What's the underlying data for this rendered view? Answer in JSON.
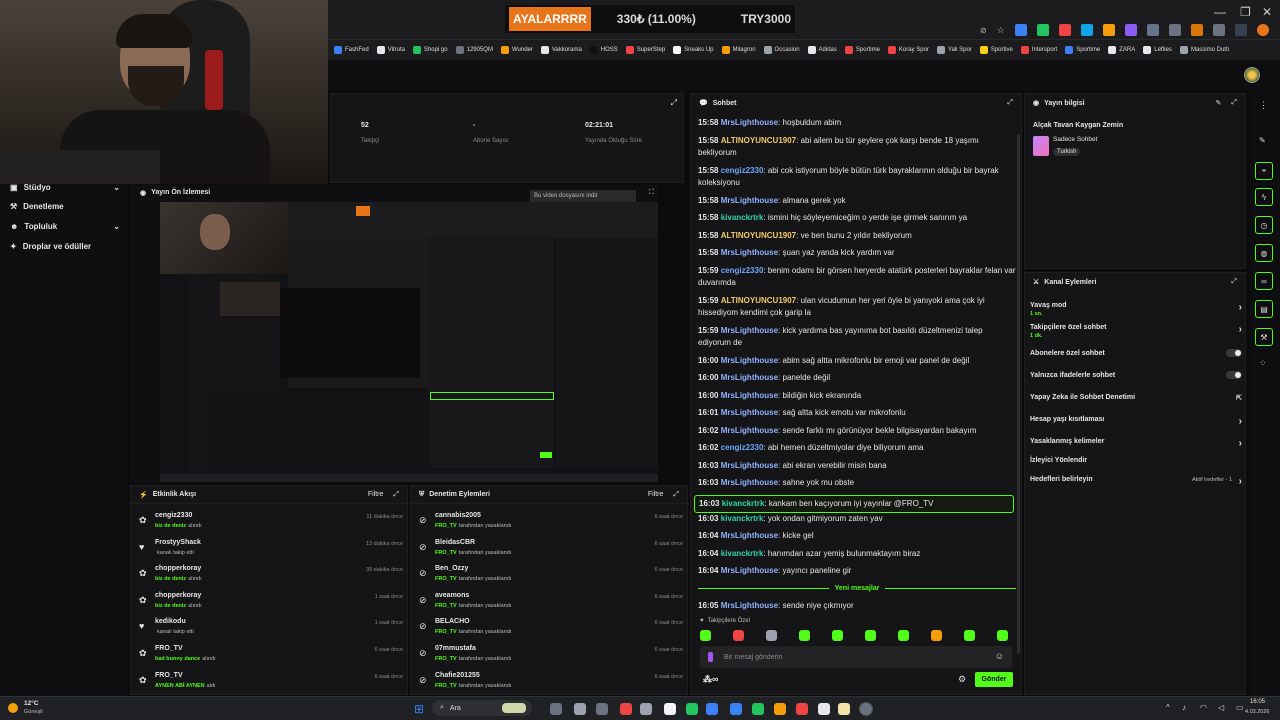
{
  "ticker": {
    "tag": "AYALARRRR",
    "pct": "330₺ (11.00%)",
    "goal": "TRY3000"
  },
  "bookmarks": [
    "FashFed",
    "Vitruta",
    "Shopi go",
    "12905QM",
    "Wunder",
    "Vakkorama",
    "HOSS",
    "SuperStep",
    "Sneaks Up",
    "Milagron",
    "Occasion",
    "Adidas",
    "Sportime",
    "Koray Spor",
    "Yali Spor",
    "Sportive",
    "Intersport",
    "Sportime",
    "ZARA",
    "Lefties",
    "Massimo Dutti"
  ],
  "sidebar": {
    "items": [
      {
        "label": "Stüdyo",
        "icon": "studio-icon"
      },
      {
        "label": "Denetleme",
        "icon": "moderation-icon"
      },
      {
        "label": "Topluluk",
        "icon": "community-icon"
      },
      {
        "label": "Droplar ve ödüller",
        "icon": "gift-icon"
      }
    ]
  },
  "stats": [
    {
      "value": "52",
      "label": "Takipçi"
    },
    {
      "value": "-",
      "label": "Abone Sayısı"
    },
    {
      "value": "02:21:01",
      "label": "Yayında Olduğu Süre"
    }
  ],
  "preview": {
    "title": "Yayın Ön İzlemesi",
    "download": "Bu video dosyasını indir"
  },
  "activity": {
    "title": "Etkinlik Akışı",
    "filter": "Filtre",
    "items": [
      {
        "name": "cengiz2330",
        "sub_hl": "biz de deniz",
        "sub": "alındı",
        "time": "11 dakika önce",
        "icon": "gift-icon"
      },
      {
        "name": "FrostyyShack",
        "sub_hl": "",
        "sub": "kanalı takip etti",
        "time": "13 dakika önce",
        "icon": "heart-icon"
      },
      {
        "name": "chopperkoray",
        "sub_hl": "biz de deniz",
        "sub": "alındı",
        "time": "39 dakika önce",
        "icon": "gift-icon"
      },
      {
        "name": "chopperkoray",
        "sub_hl": "biz de deniz",
        "sub": "alındı",
        "time": "1 saat önce",
        "icon": "gift-icon"
      },
      {
        "name": "kedikodu",
        "sub_hl": "",
        "sub": "kanalı takip etti",
        "time": "1 saat önce",
        "icon": "heart-icon"
      },
      {
        "name": "FRO_TV",
        "sub_hl": "bad bunny dance",
        "sub": "alındı",
        "time": "6 saat önce",
        "icon": "gift-icon"
      },
      {
        "name": "FRO_TV",
        "sub_hl": "AYNEN ABİ AYNEN",
        "sub": "aldı",
        "time": "6 saat önce",
        "icon": "gift-icon"
      }
    ]
  },
  "modlog": {
    "title": "Denetim Eylemleri",
    "filter": "Filtre",
    "items": [
      {
        "name": "cannabis2005",
        "by": "FRO_TV",
        "sub": "tarafından yasaklandı",
        "time": "6 saat önce"
      },
      {
        "name": "BleidasCBR",
        "by": "FRO_TV",
        "sub": "tarafından yasaklandı",
        "time": "6 saat önce"
      },
      {
        "name": "Ben_Ozzy",
        "by": "FRO_TV",
        "sub": "tarafından yasaklandı",
        "time": "6 saat önce"
      },
      {
        "name": "aveamons",
        "by": "FRO_TV",
        "sub": "tarafından yasaklandı",
        "time": "6 saat önce"
      },
      {
        "name": "BELACHO",
        "by": "FRO_TV",
        "sub": "tarafından yasaklandı",
        "time": "6 saat önce"
      },
      {
        "name": "07mmustafa",
        "by": "FRO_TV",
        "sub": "tarafından yasaklandı",
        "time": "6 saat önce"
      },
      {
        "name": "Chafie201255",
        "by": "FRO_TV",
        "sub": "tarafından yasaklandı",
        "time": "6 saat önce"
      }
    ]
  },
  "chat": {
    "title": "Sohbet",
    "messages": [
      {
        "t": "15:58",
        "u": "MrsLighthouse",
        "c": "#8fb3ff",
        "m": ": hoşbuldum abim"
      },
      {
        "t": "15:58",
        "u": "ALTINOYUNCU1907",
        "c": "#f4c96b",
        "m": ": abi ailem bu tür şeylere çok karşı bende 18 yaşımı bekliyorum"
      },
      {
        "t": "15:58",
        "u": "cengiz2330",
        "c": "#6ea8ff",
        "m": ": abi cok istiyorum böyle bütün türk bayraklarının olduğu bir bayrak koleksiyonu"
      },
      {
        "t": "15:58",
        "u": "MrsLighthouse",
        "c": "#8fb3ff",
        "m": ": almana gerek yok"
      },
      {
        "t": "15:58",
        "u": "kivanckrtrk",
        "c": "#2fd3b0",
        "m": ": ismini hiç söyleyemiceğim o yerde işe girmek sanırım ya"
      },
      {
        "t": "15:58",
        "u": "ALTINOYUNCU1907",
        "c": "#f4c96b",
        "m": ": ve ben bunu 2 yıldır bekliyorum"
      },
      {
        "t": "15:58",
        "u": "MrsLighthouse",
        "c": "#8fb3ff",
        "m": ": şuan yaz yanda kick yardım var"
      },
      {
        "t": "15:59",
        "u": "cengiz2330",
        "c": "#6ea8ff",
        "m": ": benim odamı bir görsen heryerde atatürk posterleri bayraklar felan var duvarımda"
      },
      {
        "t": "15:59",
        "u": "ALTINOYUNCU1907",
        "c": "#f4c96b",
        "m": ": ulan vicudumun her yeri öyle bi yanıyoki ama çok iyi hissediyom kendimi çok garip la"
      },
      {
        "t": "15:59",
        "u": "MrsLighthouse",
        "c": "#8fb3ff",
        "m": ": kick yardıma bas yayınıma bot basıldı düzeltmenizi talep ediyorum de"
      },
      {
        "t": "16:00",
        "u": "MrsLighthouse",
        "c": "#8fb3ff",
        "m": ": abim sağ altta mikrofonlu bir emoji var panel de değil"
      },
      {
        "t": "16:00",
        "u": "MrsLighthouse",
        "c": "#8fb3ff",
        "m": ": panelde değil"
      },
      {
        "t": "16:00",
        "u": "MrsLighthouse",
        "c": "#8fb3ff",
        "m": ": bildiğin kick ekranında"
      },
      {
        "t": "16:01",
        "u": "MrsLighthouse",
        "c": "#8fb3ff",
        "m": ": sağ altta kick emotu var mikrofonlu"
      },
      {
        "t": "16:02",
        "u": "MrsLighthouse",
        "c": "#8fb3ff",
        "m": ": sende farklı mı görünüyor bekle bilgisayardan bakayım"
      },
      {
        "t": "16:02",
        "u": "cengiz2330",
        "c": "#6ea8ff",
        "m": ": abi hemen düzeltmiyolar diye biliyorum ama"
      },
      {
        "t": "16:03",
        "u": "MrsLighthouse",
        "c": "#8fb3ff",
        "m": ": abi ekran verebilir misin bana"
      },
      {
        "t": "16:03",
        "u": "MrsLighthouse",
        "c": "#8fb3ff",
        "m": ": sahne yok mu obste"
      },
      {
        "t": "16:03",
        "u": "kivanckrtrk",
        "c": "#2fd3b0",
        "m": ": kankam ben kaçıyorum iyi yayınlar @FRO_TV"
      },
      {
        "t": "16:03",
        "u": "kivanckrtrk",
        "c": "#2fd3b0",
        "m": ": yok ondan gitmiyorum zaten yav"
      },
      {
        "t": "16:04",
        "u": "MrsLighthouse",
        "c": "#8fb3ff",
        "m": ": kicke gel"
      },
      {
        "t": "16:04",
        "u": "kivanckrtrk",
        "c": "#2fd3b0",
        "m": ": hanımdan azar yemiş bulunmaktayım biraz"
      },
      {
        "t": "16:04",
        "u": "MrsLighthouse",
        "c": "#8fb3ff",
        "m": ": yayıncı paneline gir"
      },
      {
        "t": "16:05",
        "u": "MrsLighthouse",
        "c": "#8fb3ff",
        "m": ": sende niye çıkmıyor"
      }
    ],
    "new_messages": "Yeni mesajlar",
    "followers_only": "Takipçilere Özel",
    "placeholder": "Bir mesaj gönderin",
    "send": "Gönder"
  },
  "info": {
    "title": "Yayın bilgisi",
    "stream_title": "Alçak Tavan Kaygan Zemin",
    "category": "Sadece Sohbet",
    "language": "Turkish"
  },
  "actions": {
    "title": "Kanal Eylemleri",
    "items": [
      {
        "label": "Yavaş mod",
        "sub": "1 sn.",
        "kind": "chev"
      },
      {
        "label": "Takipçilere özel sohbet",
        "sub": "1 dk.",
        "kind": "chev"
      },
      {
        "label": "Abonelere özel sohbet",
        "sub": "",
        "kind": "toggle"
      },
      {
        "label": "Yalnızca ifadelerle sohbet",
        "sub": "",
        "kind": "toggle"
      },
      {
        "label": "Yapay Zeka ile Sohbet Denetimi",
        "sub": "",
        "kind": "ext"
      },
      {
        "label": "Hesap yaşı kısıtlaması",
        "sub": "",
        "kind": "chev"
      },
      {
        "label": "Yasaklanmış kelimeler",
        "sub": "",
        "kind": "chev"
      },
      {
        "label": "İzleyici Yönlendir",
        "sub": "",
        "kind": "none"
      },
      {
        "label": "Hedefleri belirleyin",
        "sub": "",
        "kind": "goal",
        "extra": "Aktif hedefler - 1"
      }
    ]
  },
  "taskbar": {
    "weather": "12°C",
    "weather_sub": "Güneşli",
    "search": "Ara",
    "time": "16:05",
    "date": "4.03.2026"
  },
  "colors": {
    "accent": "#53fc18"
  }
}
